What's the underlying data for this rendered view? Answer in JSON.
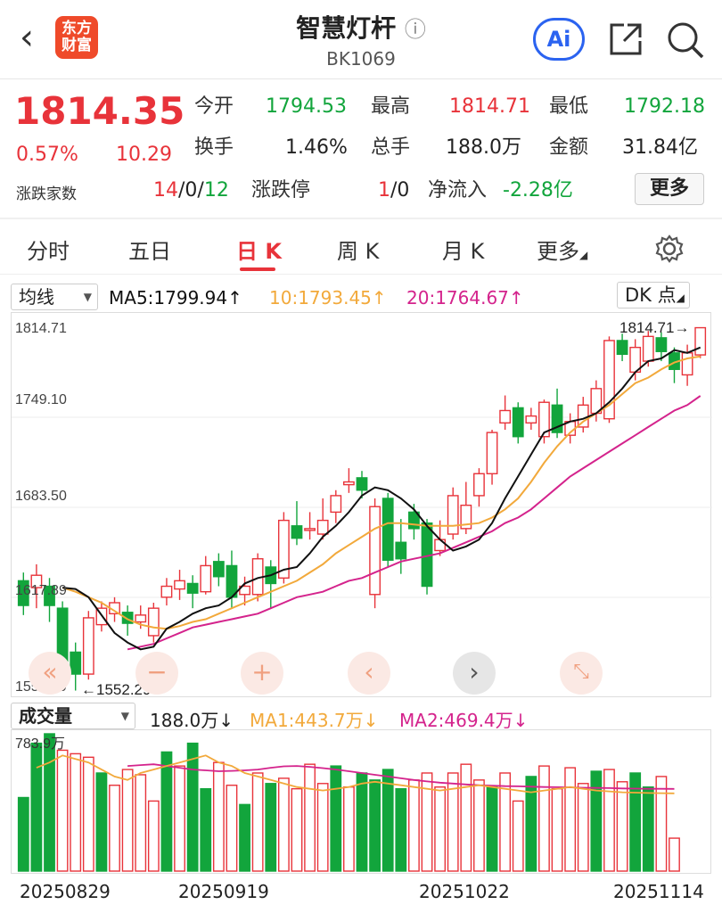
{
  "header": {
    "logo_line1": "东方",
    "logo_line2": "财富",
    "title": "智慧灯杆",
    "info_icon": "ⓘ",
    "subtitle": "BK1069",
    "ai_label": "Ai"
  },
  "quote": {
    "price": "1814.35",
    "change_pct": "0.57%",
    "change": "10.29",
    "breadth_label": "涨跌家数",
    "breadth_up": "14",
    "breadth_flat": "0",
    "breadth_down": "12",
    "open_label": "今开",
    "open": "1794.53",
    "high_label": "最高",
    "high": "1814.71",
    "low_label": "最低",
    "low": "1792.18",
    "turnover_label": "换手",
    "turnover": "1.46%",
    "volume_label": "总手",
    "volume": "188.0万",
    "amount_label": "金额",
    "amount": "31.84亿",
    "limit_label": "涨跌停",
    "limit_up": "1",
    "limit_down": "0",
    "netflow_label": "净流入",
    "netflow": "-2.28亿",
    "more_label": "更多"
  },
  "tabs": [
    "分时",
    "五日",
    "日 K",
    "周 K",
    "月 K",
    "更多"
  ],
  "tab_active": "日 K",
  "ma_bar": {
    "select_label": "均线",
    "ma5": "MA5:1799.94",
    "ma10": "10:1793.45",
    "ma20": "20:1764.67",
    "dk_label": "DK 点",
    "colors": {
      "ma5": "#111111",
      "ma10": "#f2a93b",
      "ma20": "#d4238c"
    }
  },
  "kline": {
    "y_labels": [
      "1814.71",
      "1749.10",
      "1683.50",
      "1617.89",
      "1552.29"
    ],
    "high_marker": "1814.71→",
    "low_marker": "←1552.29"
  },
  "vol_bar": {
    "select_label": "成交量",
    "vol": "188.0万",
    "ma1": "MA1:443.7万",
    "ma2": "MA2:469.4万",
    "max_label": "783.9万",
    "colors": {
      "ma1": "#f2a93b",
      "ma2": "#d4238c"
    }
  },
  "dates": [
    "20250829",
    "20250919",
    "20251022",
    "20251114"
  ],
  "colors": {
    "up": "#e8333a",
    "down": "#12a53c"
  },
  "chart_data": {
    "type": "candlestick",
    "ylim": [
      1552.29,
      1814.71
    ],
    "candles": [
      {
        "o": 1630,
        "c": 1612,
        "h": 1636,
        "l": 1605
      },
      {
        "o": 1625,
        "c": 1634,
        "h": 1642,
        "l": 1610
      },
      {
        "o": 1626,
        "c": 1612,
        "h": 1632,
        "l": 1600
      },
      {
        "o": 1610,
        "c": 1567,
        "h": 1615,
        "l": 1560
      },
      {
        "o": 1578,
        "c": 1562,
        "h": 1585,
        "l": 1550
      },
      {
        "o": 1562,
        "c": 1603,
        "h": 1608,
        "l": 1558
      },
      {
        "o": 1598,
        "c": 1610,
        "h": 1615,
        "l": 1593
      },
      {
        "o": 1606,
        "c": 1614,
        "h": 1618,
        "l": 1600
      },
      {
        "o": 1607,
        "c": 1599,
        "h": 1612,
        "l": 1590
      },
      {
        "o": 1600,
        "c": 1605,
        "h": 1612,
        "l": 1595
      },
      {
        "o": 1590,
        "c": 1610,
        "h": 1614,
        "l": 1585
      },
      {
        "o": 1618,
        "c": 1626,
        "h": 1632,
        "l": 1612
      },
      {
        "o": 1624,
        "c": 1630,
        "h": 1638,
        "l": 1616
      },
      {
        "o": 1628,
        "c": 1621,
        "h": 1634,
        "l": 1610
      },
      {
        "o": 1622,
        "c": 1641,
        "h": 1648,
        "l": 1620
      },
      {
        "o": 1644,
        "c": 1633,
        "h": 1650,
        "l": 1626
      },
      {
        "o": 1641,
        "c": 1618,
        "h": 1652,
        "l": 1610
      },
      {
        "o": 1620,
        "c": 1626,
        "h": 1633,
        "l": 1612
      },
      {
        "o": 1620,
        "c": 1646,
        "h": 1650,
        "l": 1615
      },
      {
        "o": 1640,
        "c": 1628,
        "h": 1645,
        "l": 1610
      },
      {
        "o": 1632,
        "c": 1674,
        "h": 1680,
        "l": 1628
      },
      {
        "o": 1670,
        "c": 1661,
        "h": 1688,
        "l": 1656
      },
      {
        "o": 1668,
        "c": 1668,
        "h": 1680,
        "l": 1660
      },
      {
        "o": 1664,
        "c": 1674,
        "h": 1690,
        "l": 1660
      },
      {
        "o": 1680,
        "c": 1692,
        "h": 1696,
        "l": 1672
      },
      {
        "o": 1700,
        "c": 1702,
        "h": 1712,
        "l": 1694
      },
      {
        "o": 1705,
        "c": 1696,
        "h": 1710,
        "l": 1690
      },
      {
        "o": 1620,
        "c": 1684,
        "h": 1690,
        "l": 1610
      },
      {
        "o": 1690,
        "c": 1645,
        "h": 1694,
        "l": 1640
      },
      {
        "o": 1658,
        "c": 1646,
        "h": 1675,
        "l": 1635
      },
      {
        "o": 1680,
        "c": 1668,
        "h": 1686,
        "l": 1660
      },
      {
        "o": 1672,
        "c": 1626,
        "h": 1675,
        "l": 1620
      },
      {
        "o": 1652,
        "c": 1660,
        "h": 1674,
        "l": 1648
      },
      {
        "o": 1664,
        "c": 1692,
        "h": 1698,
        "l": 1660
      },
      {
        "o": 1668,
        "c": 1685,
        "h": 1702,
        "l": 1664
      },
      {
        "o": 1692,
        "c": 1708,
        "h": 1712,
        "l": 1684
      },
      {
        "o": 1708,
        "c": 1738,
        "h": 1740,
        "l": 1700
      },
      {
        "o": 1745,
        "c": 1754,
        "h": 1765,
        "l": 1740
      },
      {
        "o": 1756,
        "c": 1735,
        "h": 1760,
        "l": 1730
      },
      {
        "o": 1745,
        "c": 1750,
        "h": 1756,
        "l": 1740
      },
      {
        "o": 1735,
        "c": 1760,
        "h": 1762,
        "l": 1730
      },
      {
        "o": 1758,
        "c": 1738,
        "h": 1770,
        "l": 1734
      },
      {
        "o": 1736,
        "c": 1746,
        "h": 1752,
        "l": 1730
      },
      {
        "o": 1742,
        "c": 1758,
        "h": 1764,
        "l": 1738
      },
      {
        "o": 1752,
        "c": 1770,
        "h": 1776,
        "l": 1746
      },
      {
        "o": 1748,
        "c": 1805,
        "h": 1808,
        "l": 1745
      },
      {
        "o": 1805,
        "c": 1795,
        "h": 1810,
        "l": 1790
      },
      {
        "o": 1782,
        "c": 1800,
        "h": 1806,
        "l": 1776
      },
      {
        "o": 1790,
        "c": 1808,
        "h": 1812,
        "l": 1786
      },
      {
        "o": 1807,
        "c": 1797,
        "h": 1811,
        "l": 1790
      },
      {
        "o": 1796,
        "c": 1784,
        "h": 1800,
        "l": 1774
      },
      {
        "o": 1780,
        "c": 1796,
        "h": 1802,
        "l": 1772
      },
      {
        "o": 1794.53,
        "c": 1814.35,
        "h": 1814.71,
        "l": 1792.18
      }
    ],
    "ma5": [
      1625,
      1624,
      1618,
      1605,
      1592,
      1585,
      1580,
      1582,
      1595,
      1600,
      1606,
      1610,
      1612,
      1618,
      1628,
      1632,
      1634,
      1638,
      1640,
      1650,
      1662,
      1670,
      1680,
      1692,
      1698,
      1696,
      1690,
      1682,
      1670,
      1660,
      1652,
      1655,
      1660,
      1672,
      1690,
      1706,
      1722,
      1738,
      1742,
      1746,
      1748,
      1752,
      1760,
      1770,
      1782,
      1790,
      1792,
      1798,
      1796,
      1799.94
    ],
    "ma10": [
      1625,
      1622,
      1618,
      1614,
      1608,
      1602,
      1598,
      1596,
      1595,
      1597,
      1600,
      1602,
      1606,
      1610,
      1614,
      1618,
      1622,
      1626,
      1630,
      1636,
      1642,
      1650,
      1656,
      1662,
      1668,
      1672,
      1672,
      1671,
      1670,
      1670,
      1670,
      1671,
      1672,
      1676,
      1682,
      1690,
      1702,
      1716,
      1728,
      1738,
      1746,
      1752,
      1758,
      1766,
      1774,
      1778,
      1784,
      1789,
      1792,
      1793.45
    ],
    "ma20": [
      1580,
      1582,
      1584,
      1588,
      1592,
      1596,
      1598,
      1600,
      1602,
      1604,
      1606,
      1610,
      1614,
      1618,
      1620,
      1622,
      1626,
      1630,
      1632,
      1636,
      1640,
      1644,
      1646,
      1648,
      1650,
      1654,
      1658,
      1662,
      1666,
      1672,
      1676,
      1682,
      1690,
      1698,
      1706,
      1712,
      1718,
      1724,
      1730,
      1736,
      1742,
      1748,
      1754,
      1758,
      1764.67
    ],
    "volumes": [
      420,
      730,
      783.9,
      690,
      670,
      650,
      560,
      490,
      580,
      550,
      400,
      680,
      600,
      730,
      470,
      620,
      490,
      380,
      560,
      500,
      530,
      470,
      610,
      500,
      600,
      480,
      560,
      520,
      580,
      470,
      520,
      560,
      480,
      560,
      610,
      520,
      480,
      560,
      400,
      540,
      600,
      470,
      590,
      500,
      570,
      580,
      510,
      560,
      480,
      540,
      188.0
    ],
    "vol_ma1": [
      590,
      620,
      660,
      640,
      620,
      580,
      540,
      520,
      560,
      580,
      600,
      620,
      640,
      660,
      620,
      600,
      560,
      540,
      520,
      500,
      480,
      470,
      460,
      470,
      480,
      500,
      510,
      500,
      490,
      480,
      470,
      460,
      470,
      480,
      490,
      480,
      470,
      460,
      450,
      460,
      470,
      480,
      470,
      460,
      455,
      450,
      448,
      446,
      445,
      443.7
    ],
    "vol_ma2": [
      600,
      605,
      610,
      600,
      590,
      580,
      575,
      570,
      572,
      575,
      580,
      590,
      598,
      600,
      595,
      588,
      580,
      570,
      560,
      550,
      540,
      530,
      520,
      512,
      505,
      500,
      495,
      490,
      488,
      485,
      484,
      482,
      480,
      479,
      478,
      476,
      475,
      474,
      472,
      471,
      470,
      470,
      469.4
    ]
  }
}
